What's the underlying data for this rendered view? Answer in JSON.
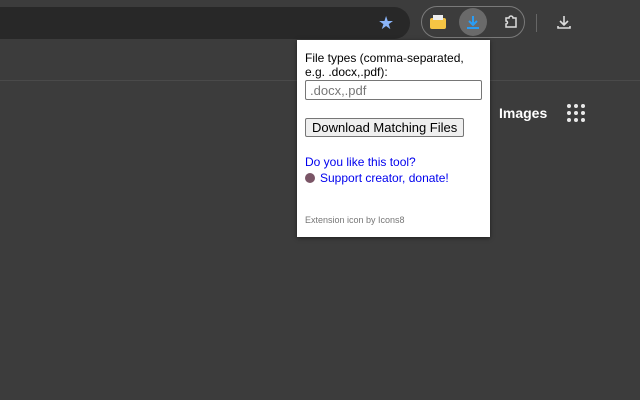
{
  "toolbar": {
    "bookmark_icon": "star-icon",
    "extensions": [
      "folder-extension-icon",
      "download-extension-icon",
      "puzzle-extensions-icon"
    ],
    "downloads_icon": "download-icon"
  },
  "page": {
    "images_link": "Images",
    "apps_icon": "grid-apps-icon"
  },
  "popup": {
    "label": "File types (comma-separated, e.g. .docx,.pdf):",
    "input_value": "",
    "input_placeholder": ".docx,.pdf",
    "download_button": "Download Matching Files",
    "like_link": "Do you like this tool?",
    "donate_link": "Support creator, donate!",
    "footer": "Extension icon by Icons8"
  }
}
